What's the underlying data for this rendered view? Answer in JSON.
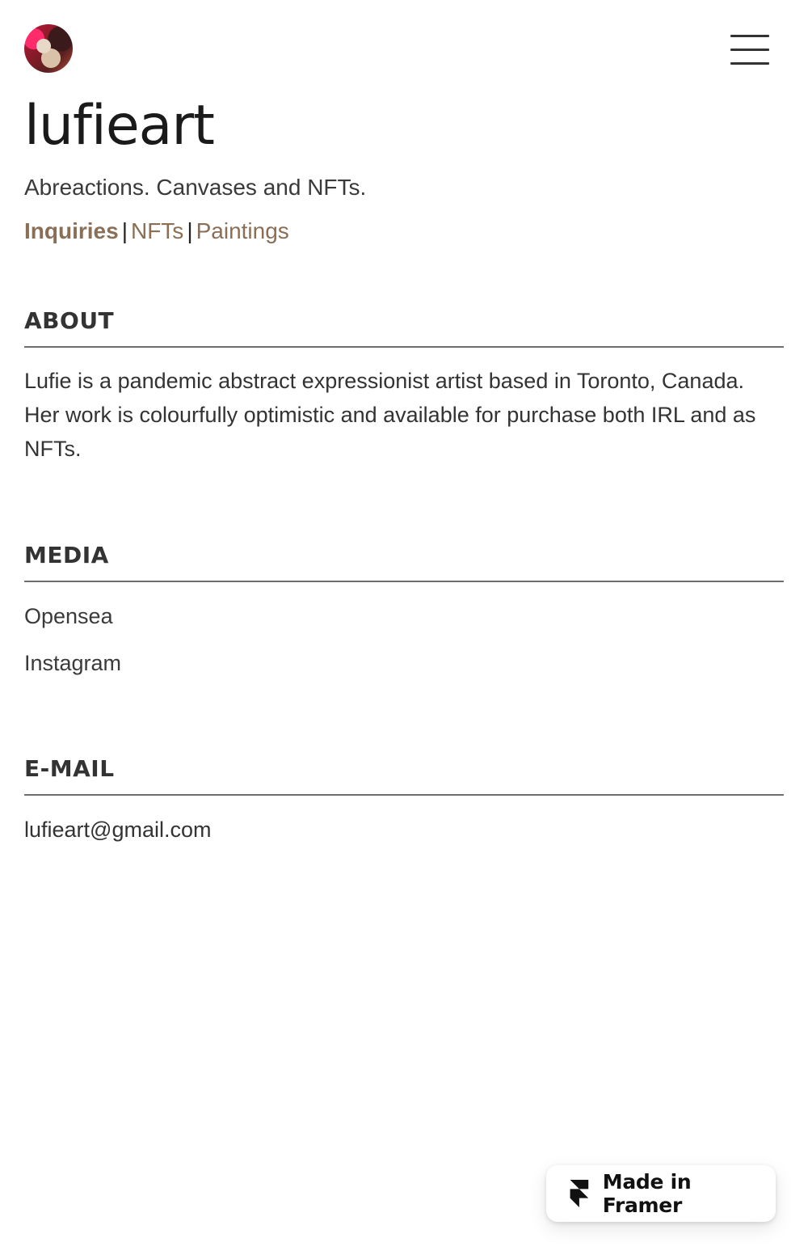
{
  "header": {
    "avatar_alt": "lufieart",
    "menu_icon": "hamburger-menu-icon"
  },
  "hero": {
    "title": "lufieart",
    "tagline": "Abreactions. Canvases and NFTs.",
    "links": [
      {
        "label": "Inquiries"
      },
      {
        "label": "NFTs"
      },
      {
        "label": "Paintings"
      }
    ],
    "separator": "|"
  },
  "about": {
    "heading": "ABOUT",
    "text": "Lufie is a pandemic abstract expressionist artist based in Toronto, Canada. Her work is colourfully optimistic and available for purchase both IRL and as NFTs."
  },
  "media": {
    "heading": "MEDIA",
    "items": [
      {
        "label": "Opensea"
      },
      {
        "label": "Instagram"
      }
    ]
  },
  "email": {
    "heading": "E-MAIL",
    "address": "lufieart@gmail.com"
  },
  "badge": {
    "label": "Made in Framer",
    "icon": "framer-logo-icon"
  },
  "colors": {
    "link": "#8a6e55",
    "text": "#333333",
    "divider": "#6e6e6e"
  }
}
